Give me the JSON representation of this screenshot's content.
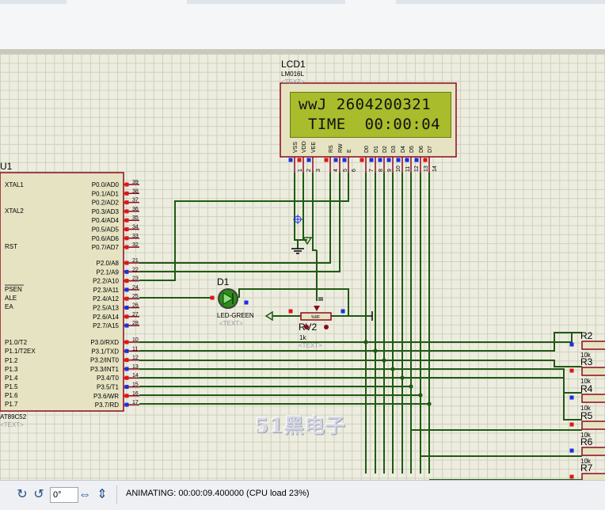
{
  "status": {
    "rotation_value": "0°",
    "message": "ANIMATING: 00:00:09.400000 (CPU load 23%)"
  },
  "lcd": {
    "ref": "LCD1",
    "part": "LM016L",
    "text_tag": "<TEXT>",
    "line1": "wwJ 2604200321",
    "line2": " TIME  00:00:04",
    "pin_names": [
      "VSS",
      "VDD",
      "VEE",
      "RS",
      "RW",
      "E",
      "D0",
      "D1",
      "D2",
      "D3",
      "D4",
      "D5",
      "D6",
      "D7"
    ],
    "pin_numbers": [
      "1",
      "2",
      "3",
      "4",
      "5",
      "6",
      "7",
      "8",
      "9",
      "10",
      "11",
      "12",
      "13",
      "14"
    ]
  },
  "mcu": {
    "ref": "U1",
    "part": "AT89C52",
    "text_tag": "<TEXT>",
    "left_pins": [
      "XTAL1",
      "XTAL2",
      "RST",
      "PSEN",
      "ALE",
      "EA",
      "P1.0/T2",
      "P1.1/T2EX",
      "P1.2",
      "P1.3",
      "P1.4",
      "P1.5",
      "P1.6",
      "P1.7"
    ],
    "p0_pins": [
      "P0.0/AD0",
      "P0.1/AD1",
      "P0.2/AD2",
      "P0.3/AD3",
      "P0.4/AD4",
      "P0.5/AD5",
      "P0.6/AD6",
      "P0.7/AD7"
    ],
    "p0_numbers": [
      "39",
      "38",
      "37",
      "36",
      "35",
      "34",
      "33",
      "32"
    ],
    "p2_pins": [
      "P2.0/A8",
      "P2.1/A9",
      "P2.2/A10",
      "P2.3/A11",
      "P2.4/A12",
      "P2.5/A13",
      "P2.6/A14",
      "P2.7/A15"
    ],
    "p2_numbers": [
      "21",
      "22",
      "23",
      "24",
      "25",
      "26",
      "27",
      "28"
    ],
    "p3_pins": [
      "P3.0/RXD",
      "P3.1/TXD",
      "P3.2/INT0",
      "P3.3/INT1",
      "P3.4/T0",
      "P3.5/T1",
      "P3.6/WR",
      "P3.7/RD"
    ],
    "p3_numbers": [
      "10",
      "11",
      "12",
      "13",
      "14",
      "15",
      "16",
      "17"
    ]
  },
  "led": {
    "ref": "D1",
    "part": "LED-GREEN",
    "text_tag": "<TEXT>"
  },
  "pot": {
    "ref": "RV2",
    "value": "1k",
    "text_tag": "<TEXT>",
    "body": "%RF"
  },
  "resistors": {
    "value": "10k",
    "refs": [
      "R2",
      "R3",
      "R4",
      "R5",
      "R6",
      "R7"
    ]
  },
  "watermark": "51黑电子",
  "colors": {
    "wire": "#1f5a12",
    "component": "#8b0a1f",
    "body_fill": "#e6e3c2",
    "lcd_screen": "#a8bc2c",
    "pin_red": "#e01515",
    "pin_blue": "#1a2fe0"
  },
  "icons": {
    "rotate_cw": "rotate-cw-icon",
    "rotate_ccw": "rotate-ccw-icon",
    "flip_h": "flip-horizontal-icon",
    "flip_v": "flip-vertical-icon"
  }
}
